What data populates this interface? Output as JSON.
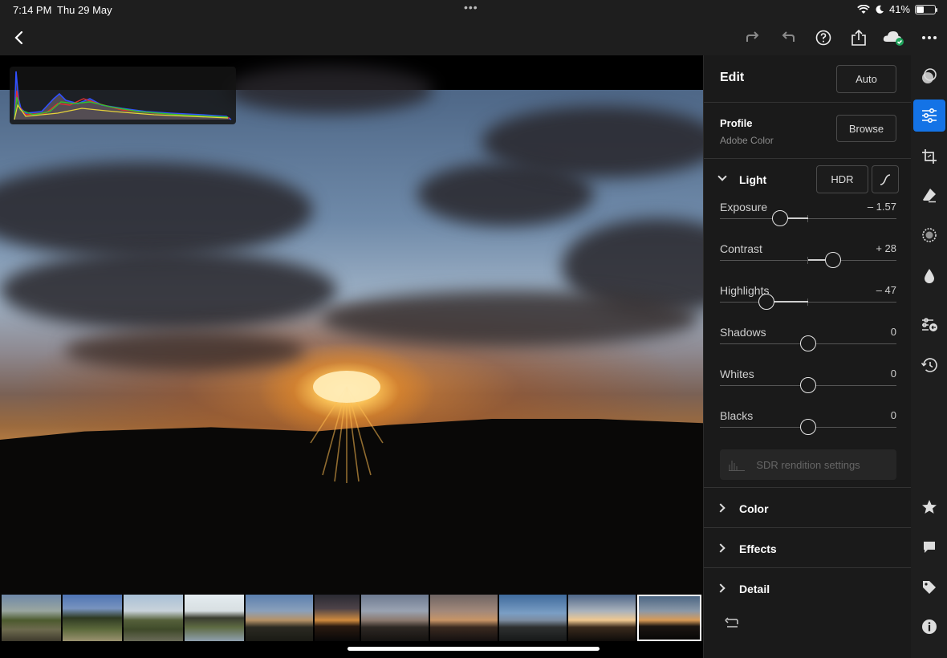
{
  "status": {
    "time": "7:14 PM",
    "date": "Thu 29 May",
    "battery": "41%",
    "battery_level": 0.41
  },
  "toolbar": {
    "back_icon": "chevron-left-icon",
    "buttons": [
      "redo-icon",
      "undo-icon",
      "help-icon",
      "share-icon",
      "cloud-synced-icon",
      "more-icon"
    ]
  },
  "edit": {
    "title": "Edit",
    "auto_label": "Auto",
    "profile_label": "Profile",
    "profile_value": "Adobe Color",
    "browse_label": "Browse",
    "light_label": "Light",
    "hdr_label": "HDR",
    "sliders": [
      {
        "name": "Exposure",
        "value": "– 1.57",
        "position": -0.314
      },
      {
        "name": "Contrast",
        "value": "+ 28",
        "position": 0.28
      },
      {
        "name": "Highlights",
        "value": "– 47",
        "position": -0.47
      },
      {
        "name": "Shadows",
        "value": "0",
        "position": 0
      },
      {
        "name": "Whites",
        "value": "0",
        "position": 0
      },
      {
        "name": "Blacks",
        "value": "0",
        "position": 0
      }
    ],
    "sdr_label": "SDR rendition settings",
    "color_label": "Color",
    "effects_label": "Effects",
    "detail_label": "Detail"
  },
  "colors": {
    "accent": "#1473e6",
    "panel_bg": "#1a1a1a",
    "toolbar_bg": "#1e1e1e"
  },
  "right_tools": [
    "presets-icon",
    "edit-sliders-icon",
    "crop-icon",
    "healing-eraser-icon",
    "masking-icon",
    "optics-drop-icon",
    "versions-icon",
    "history-icon",
    "star-rating-icon",
    "comment-icon",
    "tag-icon",
    "info-icon"
  ],
  "filmstrip": {
    "count": 11,
    "selected_index": 10
  }
}
